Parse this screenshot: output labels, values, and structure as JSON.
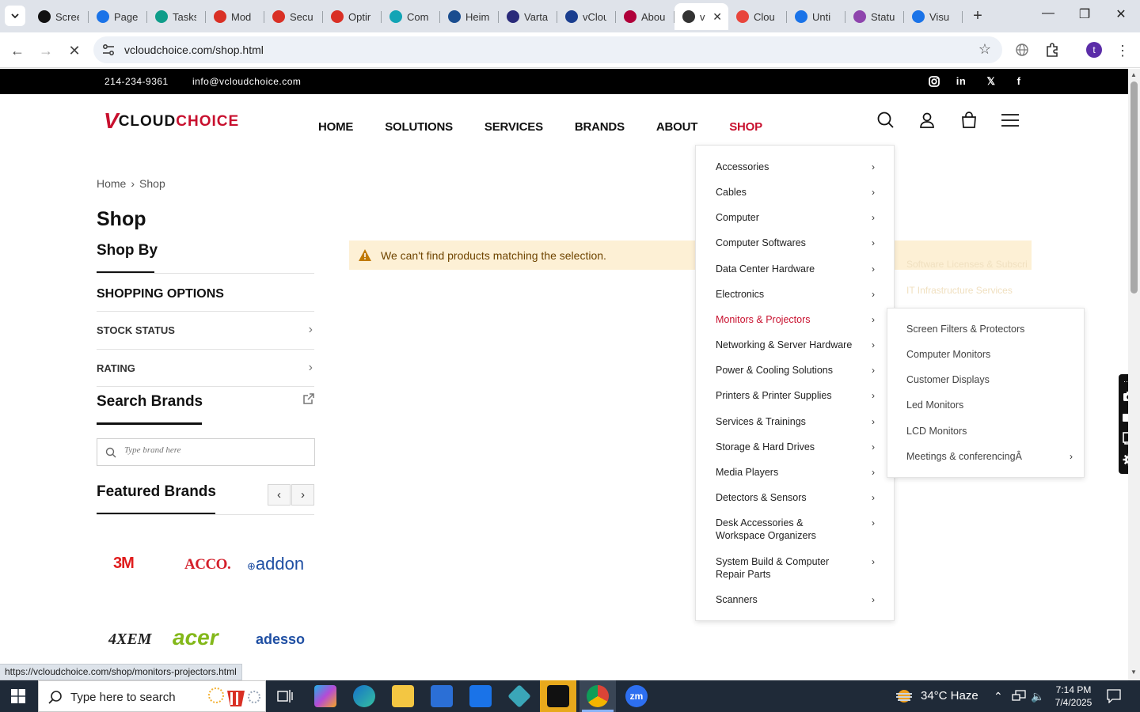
{
  "browser": {
    "tabs": [
      {
        "label": "Scree",
        "icon": "screen-icon",
        "color": "#111111"
      },
      {
        "label": "Page",
        "icon": "gauge-icon",
        "color": "#1a73e8"
      },
      {
        "label": "Tasks",
        "icon": "tasks-icon",
        "color": "#0f9d8a"
      },
      {
        "label": "Mod",
        "icon": "tag-icon",
        "color": "#d93025"
      },
      {
        "label": "Secu",
        "icon": "tag-icon",
        "color": "#d93025"
      },
      {
        "label": "Optir",
        "icon": "tag-icon",
        "color": "#d93025"
      },
      {
        "label": "Com",
        "icon": "chat-icon",
        "color": "#12a4b5"
      },
      {
        "label": "Heim",
        "icon": "scale-icon",
        "color": "#1a4d8f"
      },
      {
        "label": "Varta",
        "icon": "x-icon",
        "color": "#2a2a7a"
      },
      {
        "label": "vClou",
        "icon": "check-icon",
        "color": "#1a3e8f"
      },
      {
        "label": "Abou",
        "icon": "brush-icon",
        "color": "#b0003a"
      },
      {
        "label": "v",
        "icon": "globe-icon",
        "color": "#333333"
      },
      {
        "label": "Clou",
        "icon": "slash-icon",
        "color": "#e8453c"
      },
      {
        "label": "Unti",
        "icon": "doc-icon",
        "color": "#1a73e8"
      },
      {
        "label": "Statu",
        "icon": "pulse-icon",
        "color": "#8e44ad"
      },
      {
        "label": "Visu",
        "icon": "heartbeat-icon",
        "color": "#1a73e8"
      }
    ],
    "active_tab_index": 11,
    "url": "vcloudchoice.com/shop.html",
    "profile_initial": "t",
    "status_url": "https://vcloudchoice.com/shop/monitors-projectors.html"
  },
  "site": {
    "topbar": {
      "phone": "214-234-9361",
      "email": "info@vcloudchoice.com"
    },
    "logo": {
      "v": "V",
      "part1": "CLOUD",
      "part2": "CHOICE"
    },
    "nav": [
      "HOME",
      "SOLUTIONS",
      "SERVICES",
      "BRANDS",
      "ABOUT",
      "SHOP"
    ],
    "nav_active": "SHOP",
    "breadcrumb": {
      "home": "Home",
      "current": "Shop"
    },
    "page_title": "Shop",
    "shop_by": "Shop By",
    "shopping_options": "SHOPPING OPTIONS",
    "filters": [
      "STOCK STATUS",
      "RATING"
    ],
    "search_brands": "Search Brands",
    "brand_placeholder": "Type brand here",
    "featured_brands": "Featured Brands",
    "brands": [
      "3M",
      "ACCO.",
      "addon",
      "4XEM",
      "acer",
      "adesso"
    ],
    "notice": "We can't find products matching the selection.",
    "ghost_text": [
      "Software Licenses & Subscri",
      "IT Infrastructure Services"
    ],
    "menu": [
      "Accessories",
      "Cables",
      "Computer",
      "Computer Softwares",
      "Data Center Hardware",
      "Electronics",
      "Monitors & Projectors",
      "Networking & Server Hardware",
      "Power & Cooling Solutions",
      "Printers & Printer Supplies",
      "Services & Trainings",
      "Storage & Hard Drives",
      "Media Players",
      "Detectors & Sensors",
      "Desk Accessories & Workspace Organizers",
      "System Build & Computer Repair Parts",
      "Scanners"
    ],
    "menu_highlight": "Monitors & Projectors",
    "submenu": [
      "Screen Filters & Protectors",
      "Computer Monitors",
      "Customer Displays",
      "Led Monitors",
      "LCD Monitors",
      "Meetings & conferencingÂ"
    ],
    "accent": "#c8102e"
  },
  "taskbar": {
    "search_placeholder": "Type here to search",
    "weather": "34°C  Haze",
    "time": "7:14 PM",
    "date": "7/4/2025"
  }
}
